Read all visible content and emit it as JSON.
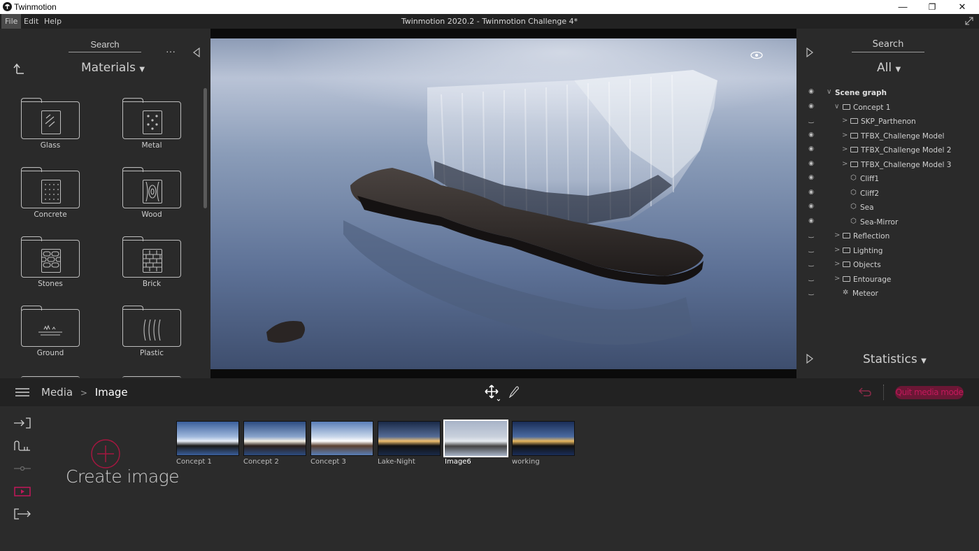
{
  "window": {
    "app_title": "Twinmotion",
    "document_title": "Twinmotion 2020.2 - Twinmotion Challenge 4*",
    "minimize": "—",
    "maximize": "❐",
    "close": "✕"
  },
  "menu": {
    "items": [
      "File",
      "Edit",
      "Help"
    ]
  },
  "library": {
    "search_label": "Search",
    "more": "···",
    "category": "Materials",
    "tiles": [
      "Glass",
      "Metal",
      "Concrete",
      "Wood",
      "Stones",
      "Brick",
      "Ground",
      "Plastic"
    ]
  },
  "scene_panel": {
    "search_label": "Search",
    "filter": "All",
    "tree": [
      {
        "label": "Scene graph",
        "visible": true,
        "expanded": true,
        "kind": "root",
        "depth": 0
      },
      {
        "label": "Concept 1",
        "visible": true,
        "expanded": true,
        "kind": "folder",
        "depth": 1
      },
      {
        "label": "SKP_Parthenon",
        "visible": false,
        "expanded": false,
        "kind": "folder",
        "depth": 2
      },
      {
        "label": "TFBX_Challenge Model",
        "visible": true,
        "expanded": false,
        "kind": "folder",
        "depth": 2
      },
      {
        "label": "TFBX_Challenge Model 2",
        "visible": true,
        "expanded": false,
        "kind": "folder",
        "depth": 2
      },
      {
        "label": "TFBX_Challenge Model 3",
        "visible": true,
        "expanded": false,
        "kind": "folder",
        "depth": 2
      },
      {
        "label": "Cliff1",
        "visible": true,
        "kind": "object",
        "depth": 2
      },
      {
        "label": "Cliff2",
        "visible": true,
        "kind": "object",
        "depth": 2
      },
      {
        "label": "Sea",
        "visible": true,
        "kind": "object",
        "depth": 2
      },
      {
        "label": "Sea-Mirror",
        "visible": true,
        "kind": "object",
        "depth": 2
      },
      {
        "label": "Reflection",
        "visible": false,
        "expanded": false,
        "kind": "folder",
        "depth": 1
      },
      {
        "label": "Lighting",
        "visible": false,
        "expanded": false,
        "kind": "folder",
        "depth": 1
      },
      {
        "label": "Objects",
        "visible": false,
        "expanded": false,
        "kind": "folder",
        "depth": 1
      },
      {
        "label": "Entourage",
        "visible": false,
        "expanded": false,
        "kind": "folder",
        "depth": 1
      },
      {
        "label": "Meteor",
        "visible": false,
        "kind": "light",
        "depth": 1
      }
    ],
    "statistics_label": "Statistics"
  },
  "media_bar": {
    "breadcrumb_root": "Media",
    "breadcrumb_current": "Image",
    "quit_label": "Quit media mode",
    "accent_color": "#c2185b"
  },
  "media": {
    "create_label": "Create image",
    "images": [
      {
        "label": "Concept 1",
        "selected": false
      },
      {
        "label": "Concept 2",
        "selected": false
      },
      {
        "label": "Concept 3",
        "selected": false
      },
      {
        "label": "Lake-Night",
        "selected": false
      },
      {
        "label": "Image6",
        "selected": true
      },
      {
        "label": "working",
        "selected": false
      }
    ]
  }
}
